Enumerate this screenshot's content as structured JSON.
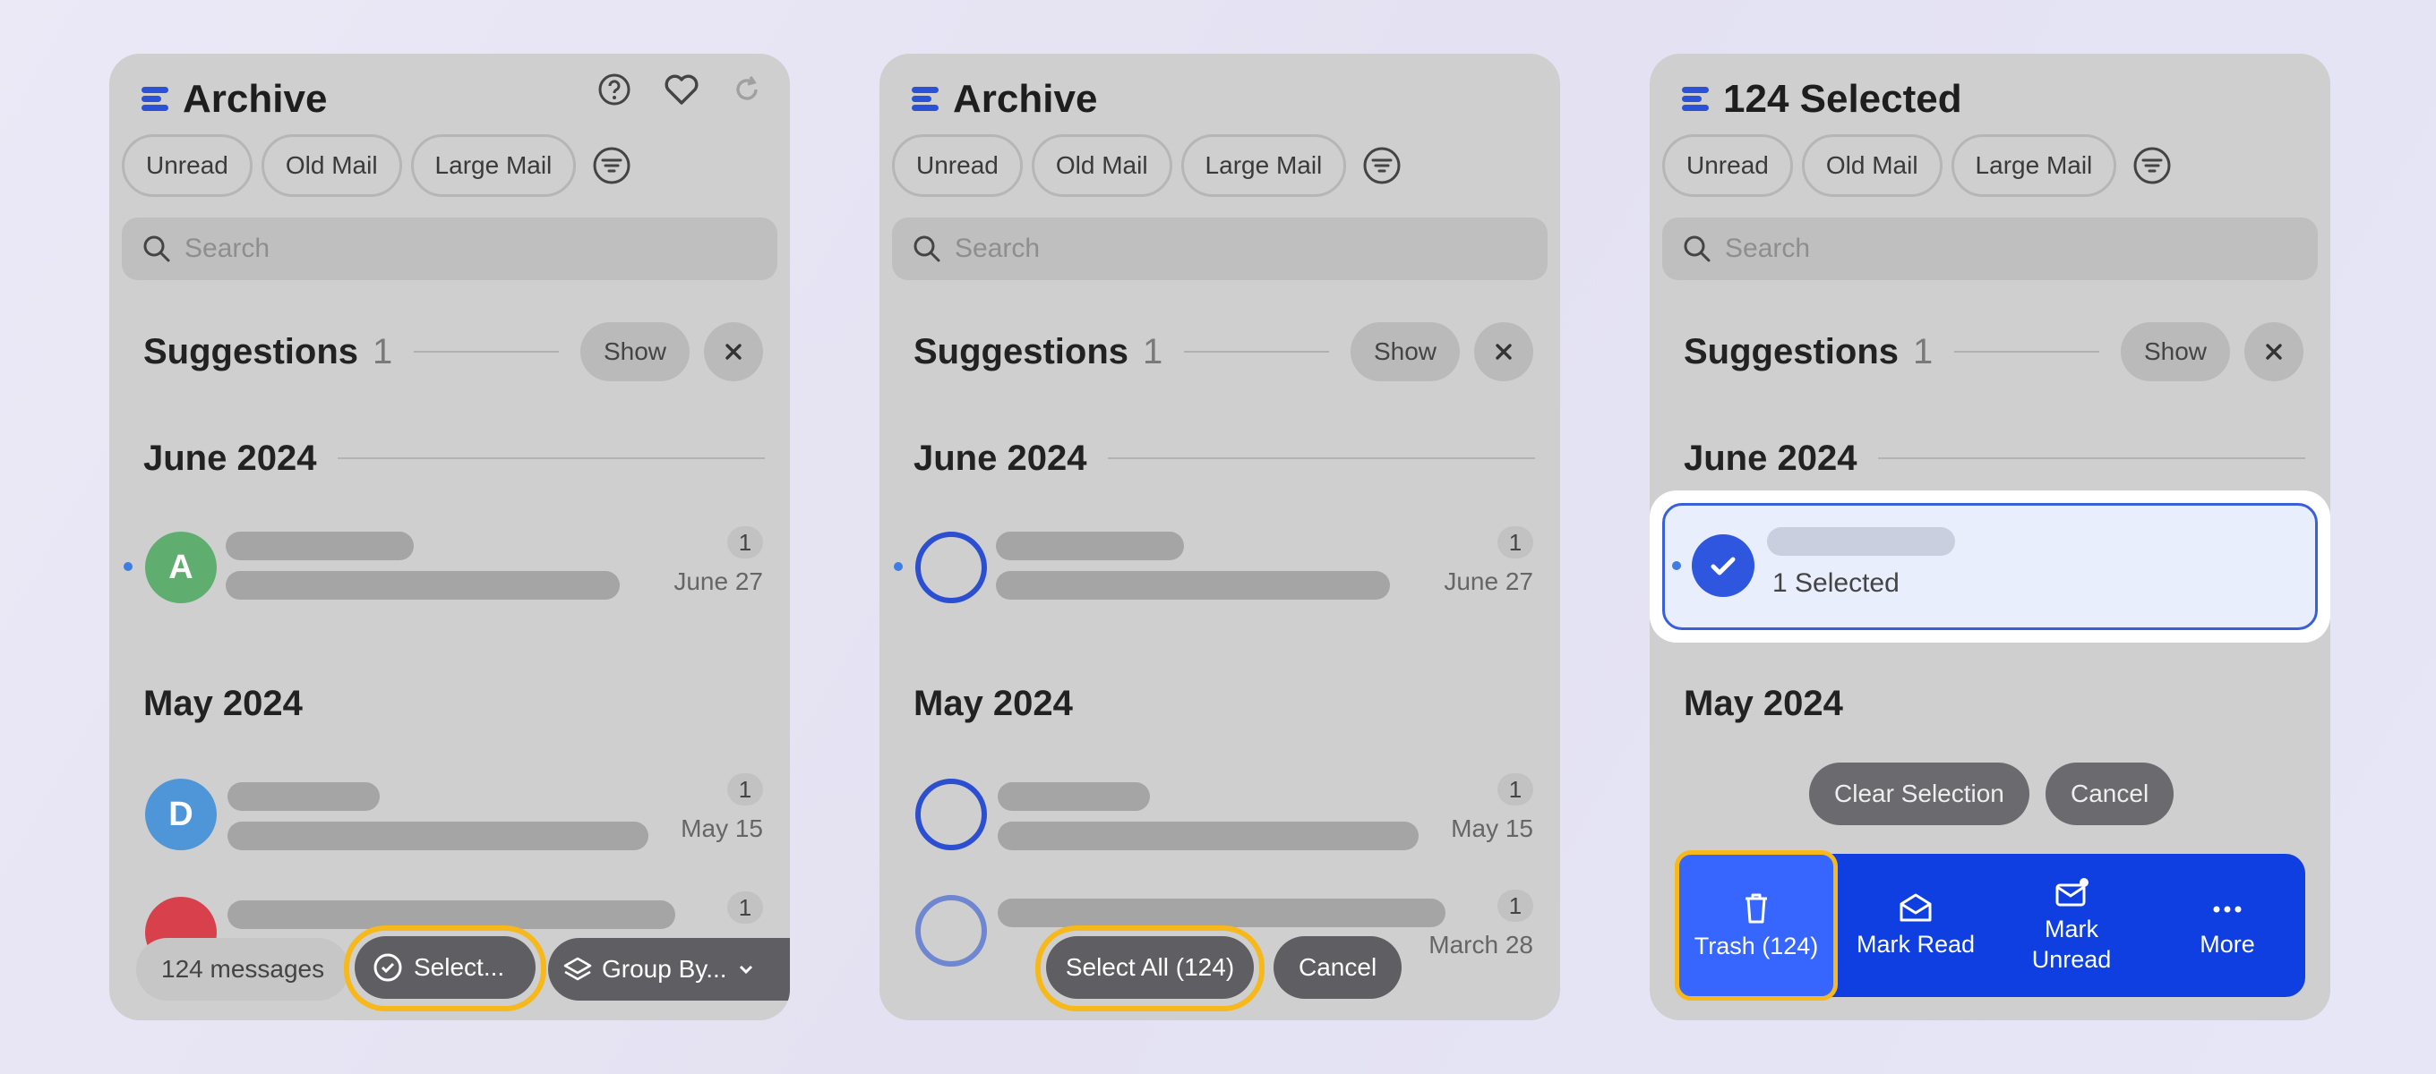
{
  "panels": [
    {
      "title": "Archive",
      "chips": [
        "Unread",
        "Old Mail",
        "Large Mail"
      ],
      "search_placeholder": "Search",
      "suggestions": {
        "label": "Suggestions",
        "count": "1",
        "show": "Show"
      },
      "sections": [
        "June 2024",
        "May 2024"
      ],
      "rows": [
        {
          "avatar": "A",
          "avatar_color": "#5fae70",
          "count": "1",
          "date": "June 27"
        },
        {
          "avatar": "D",
          "avatar_color": "#4f96d8",
          "count": "1",
          "date": "May 15"
        },
        {
          "avatar": "",
          "avatar_color": "#d8404c",
          "count": "1",
          "date": ""
        }
      ],
      "bottom": {
        "messages": "124 messages",
        "select": "Select...",
        "group_by": "Group By..."
      }
    },
    {
      "title": "Archive",
      "chips": [
        "Unread",
        "Old Mail",
        "Large Mail"
      ],
      "search_placeholder": "Search",
      "suggestions": {
        "label": "Suggestions",
        "count": "1",
        "show": "Show"
      },
      "sections": [
        "June 2024",
        "May 2024"
      ],
      "rows": [
        {
          "count": "1",
          "date": "June 27"
        },
        {
          "count": "1",
          "date": "May 15"
        },
        {
          "count": "1",
          "date": "March 28"
        }
      ],
      "bottom": {
        "select_all": "Select All (124)",
        "cancel": "Cancel"
      }
    },
    {
      "title": "124 Selected",
      "chips": [
        "Unread",
        "Old Mail",
        "Large Mail"
      ],
      "search_placeholder": "Search",
      "suggestions": {
        "label": "Suggestions",
        "count": "1",
        "show": "Show"
      },
      "sections": [
        "June 2024",
        "May 2024"
      ],
      "selected_row_label": "1 Selected",
      "clear_selection": "Clear Selection",
      "cancel": "Cancel",
      "actions": [
        {
          "label": "Trash (124)",
          "icon": "trash-icon"
        },
        {
          "label": "Mark Read",
          "icon": "envelope-open-icon"
        },
        {
          "label": "Mark Unread",
          "icon": "envelope-badge-icon"
        },
        {
          "label": "More",
          "icon": "ellipsis-icon"
        }
      ]
    }
  ],
  "colors": {
    "accent": "#2b52d6",
    "highlight": "#f6b81a",
    "action_bar": "#0f3fe0"
  }
}
